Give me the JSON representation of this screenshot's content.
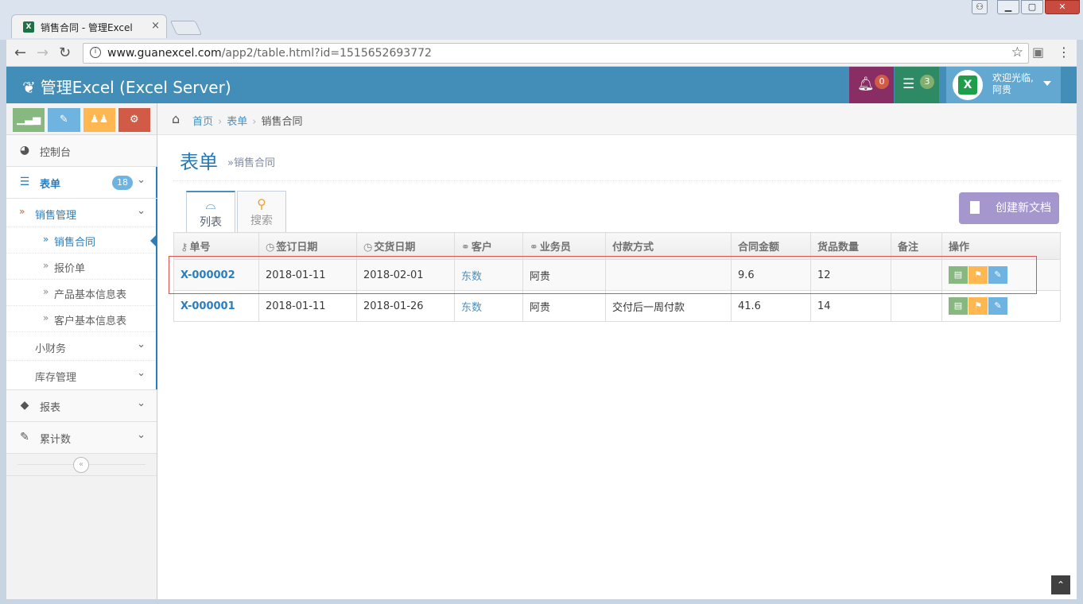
{
  "browser": {
    "tab_title": "销售合同 - 管理Excel",
    "tab_close": "×",
    "favicon": "X",
    "url_host": "www.guanexcel.com",
    "url_path": "/app2/table.html?id=1515652693772"
  },
  "navbar": {
    "brand": "管理Excel (Excel Server)",
    "notifications_count": "0",
    "tasks_count": "3",
    "user_greeting": "欢迎光临,",
    "user_name": "阿贵",
    "avatar_letter": "X"
  },
  "sidebar": {
    "items": [
      {
        "label": "控制台",
        "icon": "dashboard-icon"
      },
      {
        "label": "表单",
        "icon": "list-icon",
        "badge": "18"
      },
      {
        "label": "报表",
        "icon": "tag-icon"
      },
      {
        "label": "累计数",
        "icon": "edit-icon"
      }
    ],
    "sub": {
      "sales_mgmt": "销售管理",
      "sales_contract": "销售合同",
      "quote": "报价单",
      "product_info": "产品基本信息表",
      "customer_info": "客户基本信息表",
      "small_finance": "小财务",
      "inventory": "库存管理"
    }
  },
  "breadcrumb": {
    "home": "首页",
    "forms": "表单",
    "current": "销售合同"
  },
  "page": {
    "title": "表单",
    "subtitle": "»销售合同",
    "tab_list": "列表",
    "tab_search": "搜索",
    "create_button": "创建新文档"
  },
  "table": {
    "headers": [
      "单号",
      "签订日期",
      "交货日期",
      "客户",
      "业务员",
      "付款方式",
      "合同金额",
      "货品数量",
      "备注",
      "操作"
    ],
    "rows": [
      {
        "id": "X-000002",
        "sign_date": "2018-01-11",
        "delivery_date": "2018-02-01",
        "customer": "东数",
        "salesperson": "阿贵",
        "payment": "",
        "amount": "9.6",
        "quantity": "12",
        "note": ""
      },
      {
        "id": "X-000001",
        "sign_date": "2018-01-11",
        "delivery_date": "2018-01-26",
        "customer": "东数",
        "salesperson": "阿贵",
        "payment": "交付后一周付款",
        "amount": "41.6",
        "quantity": "14",
        "note": ""
      }
    ]
  },
  "colors": {
    "navbar": "#438eb9",
    "accent": "#2b7dbc",
    "notify_badge": "#d15b47",
    "tasks_badge": "#82af6f",
    "create_button": "#a696ce"
  }
}
